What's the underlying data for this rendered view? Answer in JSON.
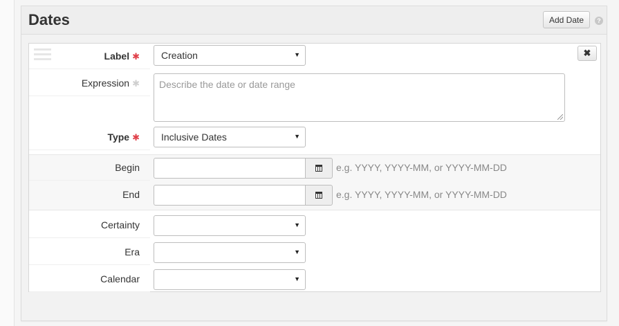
{
  "section": {
    "title": "Dates",
    "add_button": "Add Date",
    "help_icon": "?"
  },
  "record": {
    "remove_icon": "✖",
    "fields": {
      "label": {
        "label": "Label",
        "value": "Creation",
        "required": "✱"
      },
      "expression": {
        "label": "Expression",
        "placeholder": "Describe the date or date range",
        "optional_mark": "✱"
      },
      "type": {
        "label": "Type",
        "value": "Inclusive Dates",
        "required": "✱"
      },
      "begin": {
        "label": "Begin",
        "value": "",
        "hint": "e.g. YYYY, YYYY-MM, or YYYY-MM-DD"
      },
      "end": {
        "label": "End",
        "value": "",
        "hint": "e.g. YYYY, YYYY-MM, or YYYY-MM-DD"
      },
      "certainty": {
        "label": "Certainty",
        "value": ""
      },
      "era": {
        "label": "Era",
        "value": ""
      },
      "calendar": {
        "label": "Calendar",
        "value": ""
      }
    },
    "caret": "▼"
  },
  "icons": {
    "drag": "drag-handle-icon",
    "calendar": "calendar-icon",
    "remove": "close-icon",
    "help": "help-icon"
  },
  "colors": {
    "required": "#e0414a",
    "hint": "#888888"
  }
}
